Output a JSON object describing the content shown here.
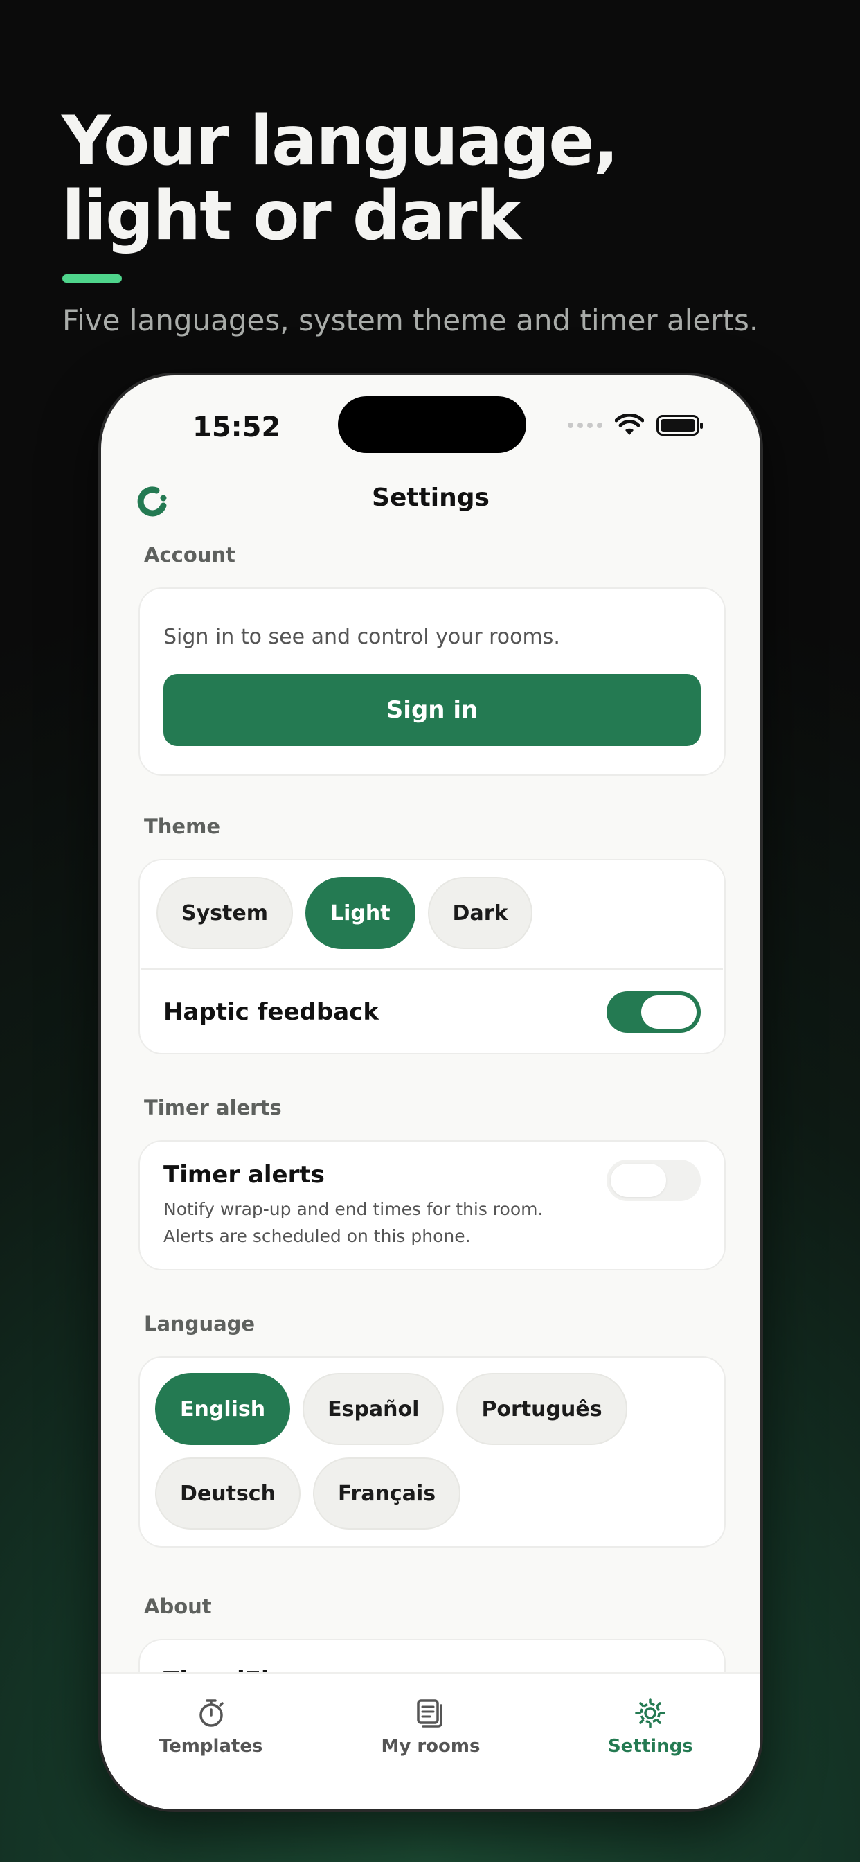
{
  "hero": {
    "title_line1": "Your language,",
    "title_line2": "light or dark",
    "subtitle": "Five languages, system theme and timer alerts."
  },
  "status_bar": {
    "time": "15:52"
  },
  "nav": {
    "title": "Settings",
    "logo_icon": "app-logo-icon"
  },
  "account": {
    "section_label": "Account",
    "description": "Sign in to see and control your rooms.",
    "sign_in_label": "Sign in"
  },
  "theme": {
    "section_label": "Theme",
    "options": [
      "System",
      "Light",
      "Dark"
    ],
    "selected": "Light",
    "haptic_label": "Haptic feedback",
    "haptic_on": true
  },
  "timer_alerts": {
    "section_label": "Timer alerts",
    "title": "Timer alerts",
    "description": "Notify wrap-up and end times for this room. Alerts are scheduled on this phone.",
    "enabled": false
  },
  "language": {
    "section_label": "Language",
    "options": [
      "English",
      "Español",
      "Português",
      "Deutsch",
      "Français"
    ],
    "selected": "English"
  },
  "about": {
    "section_label": "About",
    "app_name": "TimedFlow"
  },
  "tabs": [
    {
      "label": "Templates",
      "icon": "stopwatch-icon"
    },
    {
      "label": "My rooms",
      "icon": "rooms-list-icon"
    },
    {
      "label": "Settings",
      "icon": "gear-icon",
      "active": true
    }
  ],
  "colors": {
    "accent": "#247a52",
    "hero_accent_bar": "#4fd58c",
    "screen_background": "#f9f9f7"
  }
}
